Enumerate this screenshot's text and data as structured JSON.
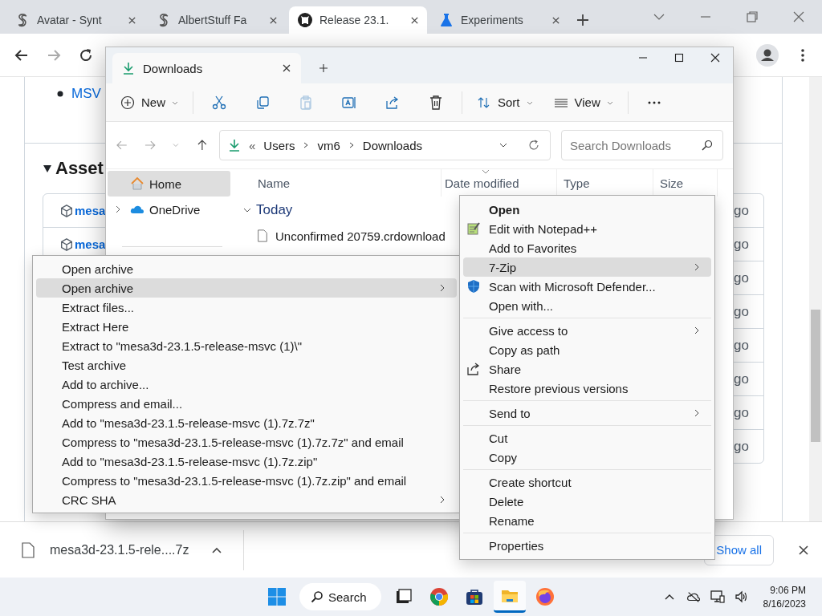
{
  "browser": {
    "tabs": [
      {
        "title": "Avatar - Synt",
        "kind": "s",
        "selected": false
      },
      {
        "title": "AlbertStuff Fa",
        "kind": "s",
        "selected": false
      },
      {
        "title": "Release 23.1.",
        "kind": "cat",
        "selected": true
      },
      {
        "title": "Experiments",
        "kind": "flask",
        "selected": false
      }
    ]
  },
  "page": {
    "list_item": "MSV",
    "assets_heading": "Asset",
    "assets": [
      {
        "name": "mesa",
        "age": "go"
      },
      {
        "name": "mesa",
        "age": "go"
      },
      {
        "age": "go"
      },
      {
        "age": "go"
      },
      {
        "age": "go"
      },
      {
        "age": "go"
      },
      {
        "age": "go"
      },
      {
        "age": "go"
      }
    ]
  },
  "explorer": {
    "tab_title": "Downloads",
    "toolbar": {
      "new": "New",
      "icons": [
        {
          "kind": "cut",
          "disabled": false
        },
        {
          "kind": "copy",
          "disabled": false
        },
        {
          "kind": "paste",
          "disabled": true
        },
        {
          "kind": "rename",
          "disabled": false
        },
        {
          "kind": "share",
          "disabled": false
        },
        {
          "kind": "delete",
          "disabled": false
        }
      ],
      "sort": "Sort",
      "view": "View"
    },
    "address": {
      "overflow": "«",
      "crumbs": [
        "Users",
        "vm6",
        "Downloads"
      ]
    },
    "search": {
      "placeholder": "Search Downloads"
    },
    "nav": [
      {
        "label": "Home",
        "kind": "home",
        "selected": true,
        "expandable": false
      },
      {
        "label": "OneDrive",
        "kind": "cloud",
        "selected": false,
        "expandable": true
      }
    ],
    "columns": [
      {
        "label": "Name",
        "sorted": false
      },
      {
        "label": "Date modified",
        "sorted": true
      },
      {
        "label": "Type",
        "sorted": false
      },
      {
        "label": "Size",
        "sorted": false
      }
    ],
    "group": {
      "label": "Today",
      "expanded": true
    },
    "files": [
      {
        "name": "Unconfirmed 20759.crdownload"
      }
    ]
  },
  "zip_menu": [
    {
      "label": "Open archive",
      "selected": false,
      "submenu": false
    },
    {
      "label": "Open archive",
      "selected": true,
      "submenu": true
    },
    {
      "label": "Extract files...",
      "selected": false,
      "submenu": false
    },
    {
      "label": "Extract Here",
      "selected": false,
      "submenu": false
    },
    {
      "label": "Extract to \"mesa3d-23.1.5-release-msvc (1)\\\"",
      "selected": false,
      "submenu": false
    },
    {
      "label": "Test archive",
      "selected": false,
      "submenu": false
    },
    {
      "label": "Add to archive...",
      "selected": false,
      "submenu": false
    },
    {
      "label": "Compress and email...",
      "selected": false,
      "submenu": false
    },
    {
      "label": "Add to \"mesa3d-23.1.5-release-msvc (1).7z.7z\"",
      "selected": false,
      "submenu": false
    },
    {
      "label": "Compress to \"mesa3d-23.1.5-release-msvc (1).7z.7z\" and email",
      "selected": false,
      "submenu": false
    },
    {
      "label": "Add to \"mesa3d-23.1.5-release-msvc (1).7z.zip\"",
      "selected": false,
      "submenu": false
    },
    {
      "label": "Compress to \"mesa3d-23.1.5-release-msvc (1).7z.zip\" and email",
      "selected": false,
      "submenu": false
    },
    {
      "label": "CRC SHA",
      "selected": false,
      "submenu": true
    }
  ],
  "context_menu": [
    [
      {
        "label": "Open",
        "bold": true,
        "selected": false,
        "submenu": false
      },
      {
        "label": "Edit with Notepad++",
        "kind": "notepad",
        "bold": false,
        "selected": false,
        "submenu": false
      },
      {
        "label": "Add to Favorites",
        "bold": false,
        "selected": false,
        "submenu": false
      },
      {
        "label": "7-Zip",
        "bold": false,
        "selected": true,
        "submenu": true
      },
      {
        "label": "Scan with Microsoft Defender...",
        "kind": "shield",
        "bold": false,
        "selected": false,
        "submenu": false
      },
      {
        "label": "Open with...",
        "bold": false,
        "selected": false,
        "submenu": false
      }
    ],
    [
      {
        "label": "Give access to",
        "bold": false,
        "selected": false,
        "submenu": true
      },
      {
        "label": "Copy as path",
        "bold": false,
        "selected": false,
        "submenu": false
      },
      {
        "label": "Share",
        "kind": "share",
        "bold": false,
        "selected": false,
        "submenu": false
      },
      {
        "label": "Restore previous versions",
        "bold": false,
        "selected": false,
        "submenu": false
      }
    ],
    [
      {
        "label": "Send to",
        "bold": false,
        "selected": false,
        "submenu": true
      }
    ],
    [
      {
        "label": "Cut",
        "bold": false,
        "selected": false,
        "submenu": false
      },
      {
        "label": "Copy",
        "bold": false,
        "selected": false,
        "submenu": false
      }
    ],
    [
      {
        "label": "Create shortcut",
        "bold": false,
        "selected": false,
        "submenu": false
      },
      {
        "label": "Delete",
        "bold": false,
        "selected": false,
        "submenu": false
      },
      {
        "label": "Rename",
        "bold": false,
        "selected": false,
        "submenu": false
      }
    ],
    [
      {
        "label": "Properties",
        "bold": false,
        "selected": false,
        "submenu": false
      }
    ]
  ],
  "downloads_bar": {
    "file": "mesa3d-23.1.5-rele....7z",
    "show_all": "Show all"
  },
  "taskbar": {
    "search": "Search",
    "apps": [
      {
        "kind": "taskview",
        "selected": false
      },
      {
        "kind": "chrome",
        "selected": false
      },
      {
        "kind": "store",
        "selected": false
      },
      {
        "kind": "explorer",
        "selected": true
      },
      {
        "kind": "firefox",
        "selected": false
      }
    ],
    "time": "9:06 PM",
    "date": "8/16/2023"
  }
}
